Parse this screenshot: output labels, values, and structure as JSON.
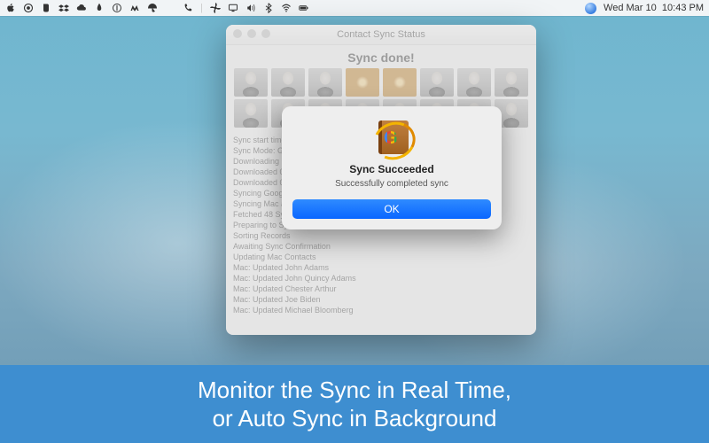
{
  "menubar": {
    "date_day": "Wed",
    "date_mon": "Mar",
    "date_num": "10",
    "time": "10:43 PM"
  },
  "window": {
    "title": "Contact Sync Status",
    "heading": "Sync done!",
    "log": [
      "Sync start time: 0",
      "Sync Mode: Goo",
      "Downloading Goo",
      "Downloaded 0 Gr",
      "Downloaded 0 Gr",
      "Syncing Google a",
      "Syncing Mac add",
      "Fetched 48 Sync",
      "Preparing to Syn",
      "Sorting Records",
      "Awaiting Sync Confirmation",
      "Updating Mac Contacts",
      "Mac: Updated John Adams",
      "Mac: Updated John Quincy Adams",
      "Mac: Updated Chester Arthur",
      "Mac: Updated Joe Biden",
      "Mac: Updated Michael Bloomberg"
    ]
  },
  "dialog": {
    "title": "Sync Succeeded",
    "message": "Successfully completed sync",
    "ok": "OK"
  },
  "caption": {
    "line1": "Monitor the Sync in Real Time,",
    "line2": "or Auto Sync in Background"
  }
}
